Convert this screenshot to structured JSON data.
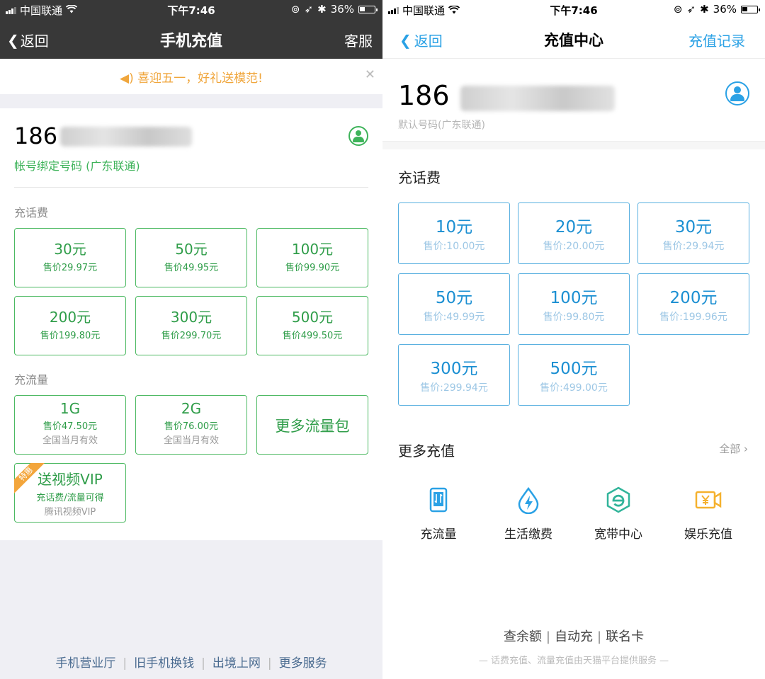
{
  "status": {
    "carrier": "中国联通",
    "time": "下午7:46",
    "battery": "36%"
  },
  "left": {
    "nav": {
      "back": "返回",
      "title": "手机充值",
      "service": "客服"
    },
    "banner": {
      "text": "喜迎五一，好礼送模范!"
    },
    "account": {
      "phone_prefix": "186",
      "binding_label": "帐号绑定号码 (广东联通)"
    },
    "sections": {
      "topup": "充话费",
      "data": "充流量"
    },
    "topup_options": [
      {
        "amount": "30元",
        "price": "售价29.97元"
      },
      {
        "amount": "50元",
        "price": "售价49.95元"
      },
      {
        "amount": "100元",
        "price": "售价99.90元"
      },
      {
        "amount": "200元",
        "price": "售价199.80元"
      },
      {
        "amount": "300元",
        "price": "售价299.70元"
      },
      {
        "amount": "500元",
        "price": "售价499.50元"
      }
    ],
    "data_options": [
      {
        "amount": "1G",
        "price": "售价47.50元",
        "note": "全国当月有效"
      },
      {
        "amount": "2G",
        "price": "售价76.00元",
        "note": "全国当月有效"
      },
      {
        "amount": "更多流量包"
      }
    ],
    "vip": {
      "ribbon": "特惠",
      "title": "送视频VIP",
      "desc": "充话费/流量可得",
      "note": "腾讯视频VIP"
    },
    "footer": [
      "手机营业厅",
      "旧手机换钱",
      "出境上网",
      "更多服务"
    ],
    "colors": {
      "accent": "#3eb35a",
      "header": "#383838",
      "banner_text": "#f0a63c"
    }
  },
  "right": {
    "nav": {
      "back": "返回",
      "title": "充值中心",
      "record": "充值记录"
    },
    "account": {
      "phone_prefix": "186",
      "default_label": "默认号码(广东联通)"
    },
    "sections": {
      "topup": "充话费",
      "more": "更多充值",
      "all": "全部"
    },
    "topup_options": [
      {
        "amount": "10元",
        "price": "售价:10.00元"
      },
      {
        "amount": "20元",
        "price": "售价:20.00元"
      },
      {
        "amount": "30元",
        "price": "售价:29.94元"
      },
      {
        "amount": "50元",
        "price": "售价:49.99元"
      },
      {
        "amount": "100元",
        "price": "售价:99.80元"
      },
      {
        "amount": "200元",
        "price": "售价:199.96元"
      },
      {
        "amount": "300元",
        "price": "售价:299.94元"
      },
      {
        "amount": "500元",
        "price": "售价:499.00元"
      }
    ],
    "quick": [
      {
        "label": "充流量",
        "icon": "phone-data-icon"
      },
      {
        "label": "生活缴费",
        "icon": "water-drop-bolt-icon"
      },
      {
        "label": "宽带中心",
        "icon": "broadband-e-icon"
      },
      {
        "label": "娱乐充值",
        "icon": "yuan-video-icon"
      }
    ],
    "links": [
      "查余额",
      "自动充",
      "联名卡"
    ],
    "note": "— 话费充值、流量充值由天猫平台提供服务 —",
    "colors": {
      "accent": "#2aa1e5",
      "orange_icon": "#f5b12e",
      "green_icon": "#31b49a"
    }
  }
}
